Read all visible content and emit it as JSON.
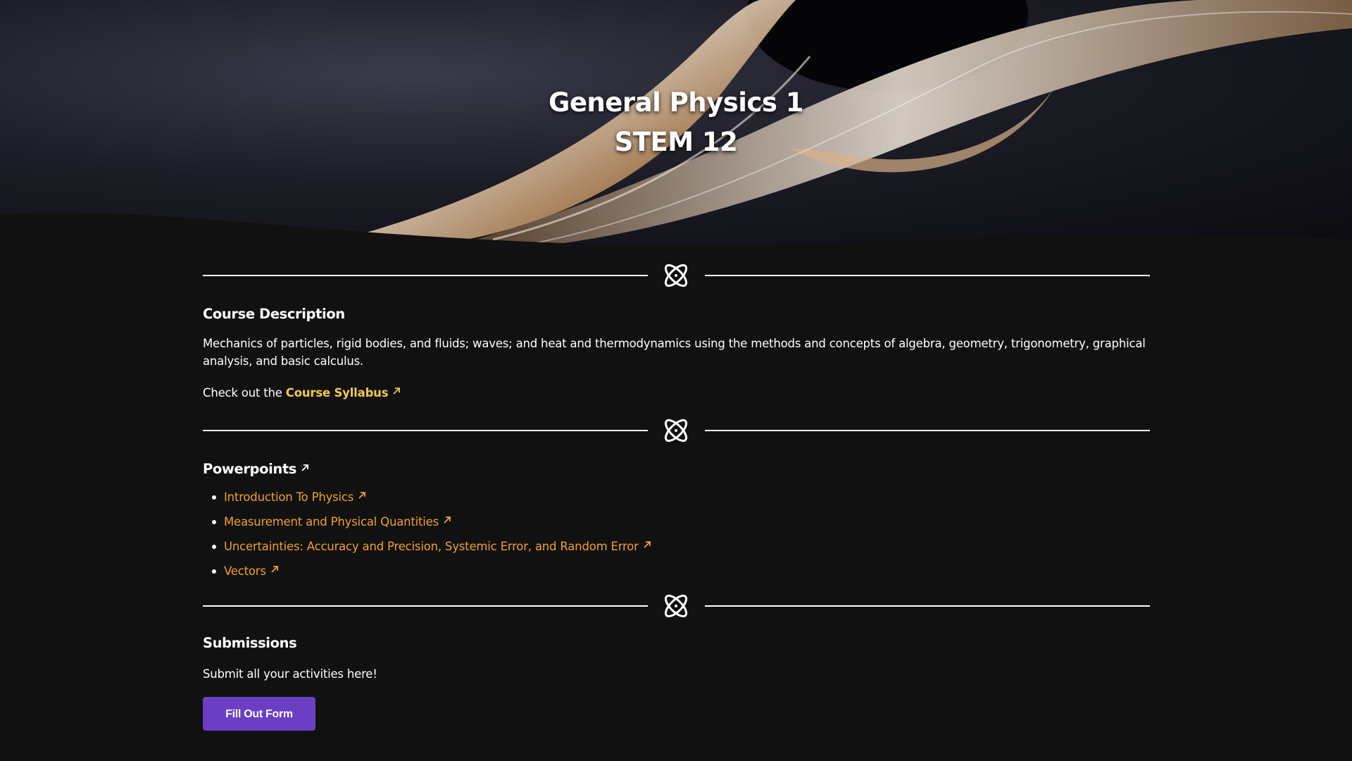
{
  "hero": {
    "title_line1": "General Physics 1",
    "title_line2": "STEM 12"
  },
  "description": {
    "heading": "Course Description",
    "body": "Mechanics of particles, rigid bodies, and fluids; waves; and heat and thermodynamics using the methods and concepts of algebra, geometry, trigonometry, graphical analysis, and basic calculus.",
    "syllabus_prefix": "Check out the",
    "syllabus_link": "Course Syllabus"
  },
  "powerpoints": {
    "heading": "Powerpoints",
    "items": [
      {
        "label": "Introduction To Physics"
      },
      {
        "label": "Measurement and Physical Quantities"
      },
      {
        "label": "Uncertainties: Accuracy and Precision, Systemic Error, and Random Error"
      },
      {
        "label": "Vectors"
      }
    ]
  },
  "submissions": {
    "heading": "Submissions",
    "body": "Submit all your activities here!",
    "button_label": "Fill Out Form"
  },
  "icons": {
    "divider": "atom-icon",
    "external": "external-link-arrow-icon"
  },
  "colors": {
    "background": "#111111",
    "link_yellow": "#f2c94c",
    "link_orange": "#f0a030",
    "button_purple": "#6a3fc4"
  }
}
